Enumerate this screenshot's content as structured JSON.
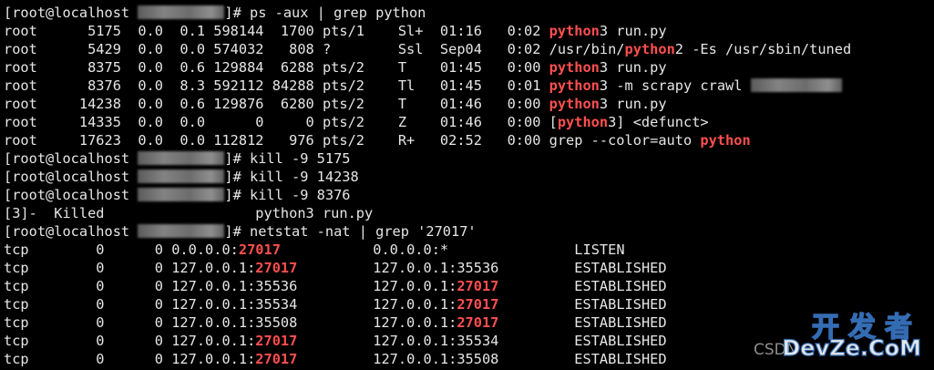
{
  "terminal": {
    "lines": [
      [
        {
          "t": "[root@localhost "
        },
        {
          "b": "host"
        },
        {
          "t": "]# ps -aux | grep python"
        }
      ],
      [
        {
          "t": "root      5175  0.0  0.1 598144  1700 pts/1    Sl+  01:16   0:02 "
        },
        {
          "h": "python"
        },
        {
          "t": "3 run.py"
        }
      ],
      [
        {
          "t": "root      5429  0.0  0.0 574032   808 ?        Ssl  Sep04   0:02 /usr/bin/"
        },
        {
          "h": "python"
        },
        {
          "t": "2 -Es /usr/sbin/tuned"
        }
      ],
      [
        {
          "t": "root      8375  0.0  0.6 129884  6288 pts/2    T    01:45   0:00 "
        },
        {
          "h": "python"
        },
        {
          "t": "3 run.py"
        }
      ],
      [
        {
          "t": "root      8376  0.0  8.3 592112 84288 pts/2    Tl   01:45   0:01 "
        },
        {
          "h": "python"
        },
        {
          "t": "3 -m scrapy crawl "
        },
        {
          "b": "spider"
        }
      ],
      [
        {
          "t": "root     14238  0.0  0.6 129876  6280 pts/2    T    01:46   0:00 "
        },
        {
          "h": "python"
        },
        {
          "t": "3 run.py"
        }
      ],
      [
        {
          "t": "root     14335  0.0  0.0      0     0 pts/2    Z    01:46   0:00 ["
        },
        {
          "h": "python"
        },
        {
          "t": "3] <defunct>"
        }
      ],
      [
        {
          "t": "root     17623  0.0  0.0 112812   976 pts/2    R+   02:52   0:00 grep --color=auto "
        },
        {
          "h": "python"
        }
      ],
      [
        {
          "t": "[root@localhost "
        },
        {
          "b": "host"
        },
        {
          "t": "]# kill -9 5175"
        }
      ],
      [
        {
          "t": "[root@localhost "
        },
        {
          "b": "host"
        },
        {
          "t": "]# kill -9 14238"
        }
      ],
      [
        {
          "t": "[root@localhost "
        },
        {
          "b": "host"
        },
        {
          "t": "]# kill -9 8376"
        }
      ],
      [
        {
          "t": "[3]-  Killed                  python3 run.py"
        }
      ],
      [
        {
          "t": "[root@localhost "
        },
        {
          "b": "host"
        },
        {
          "t": "]# netstat -nat | grep '27017'"
        }
      ],
      [
        {
          "t": "tcp        0      0 0.0.0.0:"
        },
        {
          "h": "27017"
        },
        {
          "t": "           0.0.0.0:*               LISTEN"
        }
      ],
      [
        {
          "t": "tcp        0      0 127.0.0.1:"
        },
        {
          "h": "27017"
        },
        {
          "t": "         127.0.0.1:35536         ESTABLISHED"
        }
      ],
      [
        {
          "t": "tcp        0      0 127.0.0.1:35536         127.0.0.1:"
        },
        {
          "h": "27017"
        },
        {
          "t": "         ESTABLISHED"
        }
      ],
      [
        {
          "t": "tcp        0      0 127.0.0.1:35534         127.0.0.1:"
        },
        {
          "h": "27017"
        },
        {
          "t": "         ESTABLISHED"
        }
      ],
      [
        {
          "t": "tcp        0      0 127.0.0.1:35508         127.0.0.1:"
        },
        {
          "h": "27017"
        },
        {
          "t": "         ESTABLISHED"
        }
      ],
      [
        {
          "t": "tcp        0      0 127.0.0.1:"
        },
        {
          "h": "27017"
        },
        {
          "t": "         127.0.0.1:35534         ESTABLISHED"
        }
      ],
      [
        {
          "t": "tcp        0      0 127.0.0.1:"
        },
        {
          "h": "27017"
        },
        {
          "t": "         127.0.0.1:35508         ESTABLISHED"
        }
      ]
    ]
  },
  "colors": {
    "background": "#000000",
    "text": "#e6e6e6",
    "highlight": "#ff4f4f",
    "watermark_outline": "#3a78c8"
  },
  "watermark": {
    "csdn": "CSDN",
    "cn": "开发者",
    "en": "DevZe.CoM"
  }
}
